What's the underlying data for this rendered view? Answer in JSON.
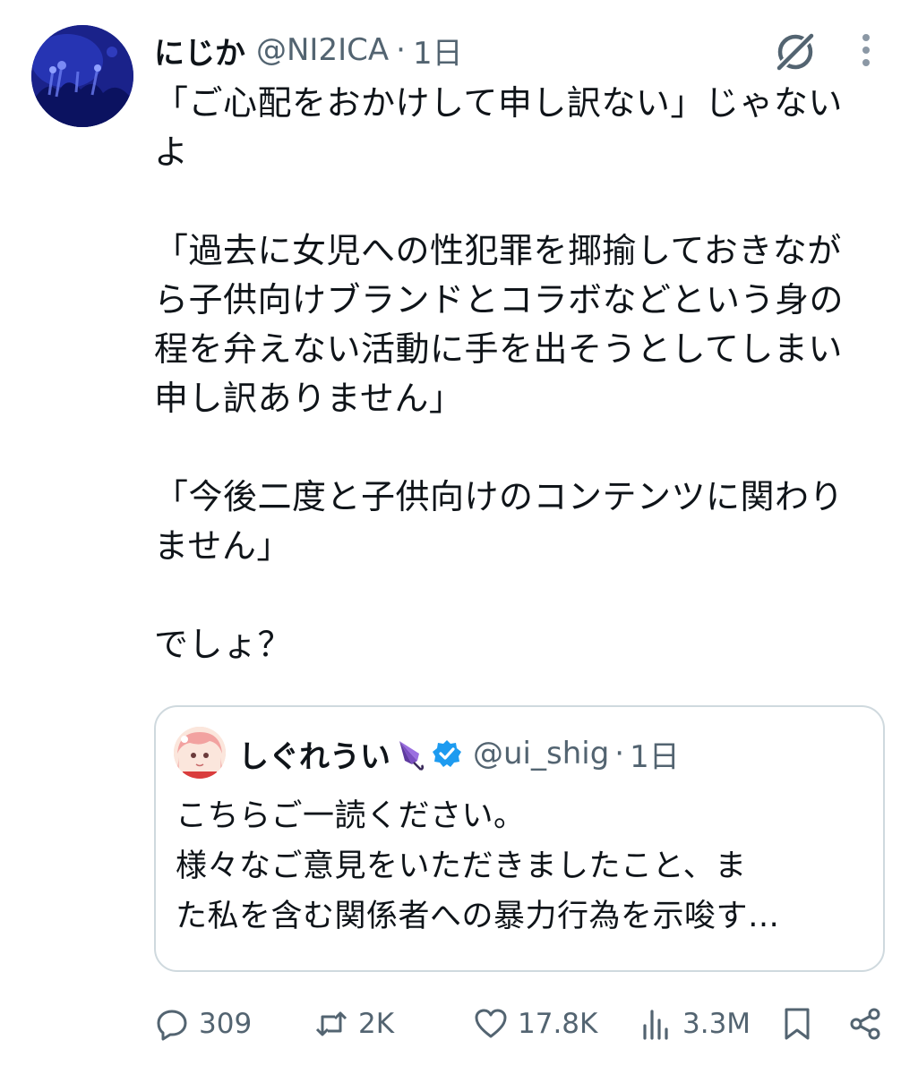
{
  "tweet": {
    "display_name": "にじか",
    "handle": "@NI2ICA",
    "separator": "·",
    "time": "1日",
    "avatar_icon": "aquarium-avatar",
    "text": "「ご心配をおかけして申し訳ない」じゃない\nよ\n\n「過去に女児への性犯罪を揶揄しておきなが\nら子供向けブランドとコラボなどという身の\n程を弁えない活動に手を出そうとしてしまい\n申し訳ありません」\n\n「今後二度と子供向けのコンテンツに関わり\nません」\n\nでしょ？"
  },
  "quote": {
    "display_name": "しぐれうい",
    "emoji": "umbrella-icon",
    "verified_icon": "verified-badge-icon",
    "verified_color": "#1d9bf0",
    "handle": "@ui_shig",
    "separator": "·",
    "time": "1日",
    "text": "こちらご一読ください。\n様々なご意見をいただきましたこと、ま\nた私を含む関係者への暴力行為を示唆す…"
  },
  "actions": {
    "replies": "309",
    "retweets": "2K",
    "likes": "17.8K",
    "views": "3.3M"
  },
  "colors": {
    "text": "#0f1419",
    "secondary": "#536471",
    "border": "#cfd9de"
  }
}
